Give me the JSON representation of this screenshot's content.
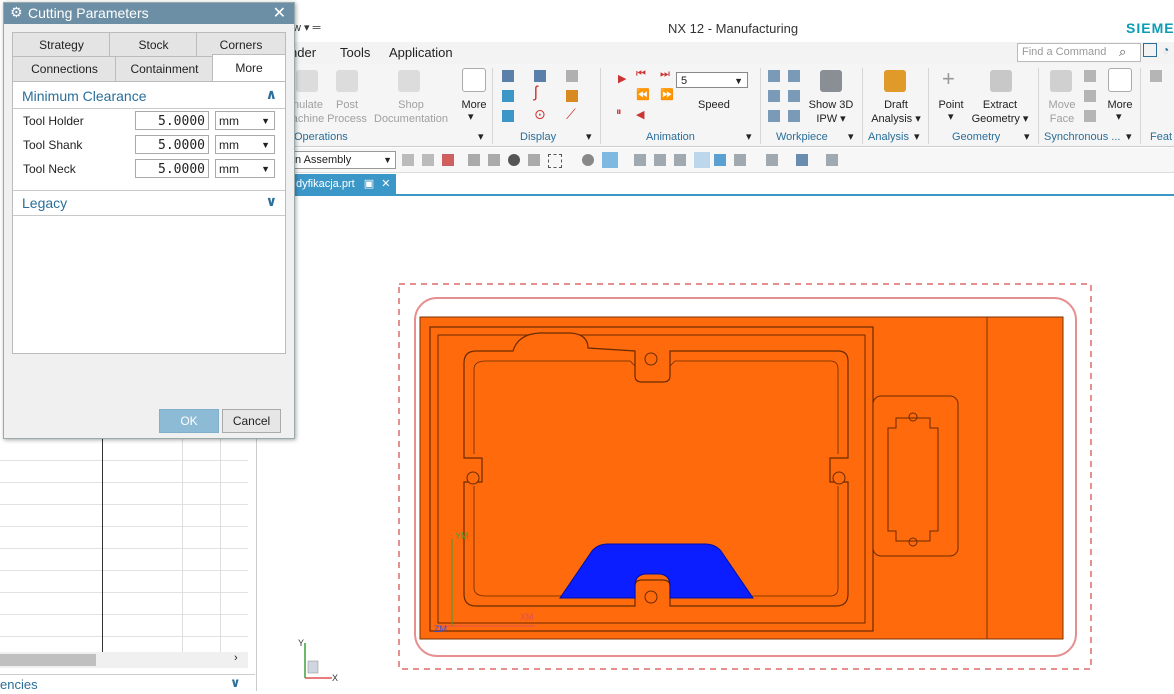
{
  "app": {
    "title": "NX 12 - Manufacturing",
    "brand": "SIEMEN",
    "view_menu": "w ▾ ═"
  },
  "menu": {
    "items": [
      "nder",
      "Tools",
      "Application"
    ],
    "find_placeholder": "Find a Command"
  },
  "ribbon": {
    "operations": {
      "group_label": "Operations",
      "items": [
        "nulate\nachine",
        "Post\nProcess",
        "Shop\nDocumentation",
        "More"
      ]
    },
    "display": {
      "group_label": "Display"
    },
    "animation": {
      "group_label": "Animation",
      "speed_value": "5",
      "speed_label": "Speed"
    },
    "workpiece": {
      "group_label": "Workpiece",
      "show3d_label": "Show 3D\nIPW ▾"
    },
    "analysis": {
      "group_label": "Analysis",
      "draft_label": "Draft\nAnalysis ▾"
    },
    "geometry": {
      "group_label": "Geometry",
      "point_label": "Point",
      "extract_label": "Extract\nGeometry ▾"
    },
    "synchronous": {
      "group_label": "Synchronous ...",
      "move_face_label": "Move\nFace",
      "more_label": "More"
    },
    "feat": {
      "group_label": "Feat"
    }
  },
  "toolbar2": {
    "assembly_select": "n Assembly"
  },
  "file_tab": {
    "label": "dyfikacja.prt"
  },
  "viewport": {
    "axis_labels": {
      "ym": "YM",
      "xm": "XM",
      "zm": "ZM"
    },
    "triad_labels": {
      "y": "Y",
      "x": "X"
    },
    "colors": {
      "part": "#ff6a0d",
      "machined": "#0a1eff",
      "boundary": "#e58f8f"
    }
  },
  "left_nav": {
    "bottom_label": "encies"
  },
  "dialog": {
    "title": "Cutting Parameters",
    "close_glyph": "✕",
    "tabs_row1": [
      "Strategy",
      "Stock",
      "Corners"
    ],
    "tabs_row2": [
      "Connections",
      "Containment",
      "More"
    ],
    "active_tab": "More",
    "section_min_clearance": "Minimum Clearance",
    "params": [
      {
        "label": "Tool Holder",
        "value": "5.0000",
        "unit": "mm"
      },
      {
        "label": "Tool Shank",
        "value": "5.0000",
        "unit": "mm"
      },
      {
        "label": "Tool Neck",
        "value": "5.0000",
        "unit": "mm"
      }
    ],
    "section_legacy": "Legacy",
    "ok_label": "OK",
    "cancel_label": "Cancel"
  }
}
